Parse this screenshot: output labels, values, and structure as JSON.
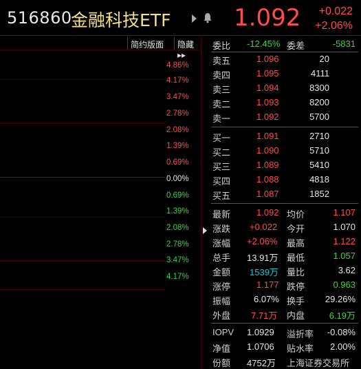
{
  "header": {
    "code": "516860",
    "name": "金融科技ETF",
    "price": "1.092",
    "change_abs": "+0.022",
    "change_pct": "+2.06%"
  },
  "chart": {
    "toolbar": {
      "simple_layout": "简约版面",
      "hide": "隐藏 ▸▸"
    },
    "pct_labels": [
      "4.86%",
      "4.17%",
      "3.47%",
      "2.78%",
      "2.08%",
      "1.39%",
      "0.69%",
      "0.00%",
      "0.69%",
      "1.39%",
      "2.08%",
      "2.78%",
      "3.47%",
      "4.17%"
    ]
  },
  "commission": {
    "ratio_label": "委比",
    "ratio": "-12.45%",
    "diff_label": "委差",
    "diff": "-5831"
  },
  "asks": [
    {
      "label": "卖五",
      "price": "1.096",
      "vol": "20"
    },
    {
      "label": "卖四",
      "price": "1.095",
      "vol": "4111"
    },
    {
      "label": "卖三",
      "price": "1.094",
      "vol": "8300"
    },
    {
      "label": "卖二",
      "price": "1.093",
      "vol": "8200"
    },
    {
      "label": "卖一",
      "price": "1.092",
      "vol": "5700"
    }
  ],
  "bids": [
    {
      "label": "买一",
      "price": "1.091",
      "vol": "2710"
    },
    {
      "label": "买二",
      "price": "1.090",
      "vol": "5710"
    },
    {
      "label": "买三",
      "price": "1.089",
      "vol": "5410"
    },
    {
      "label": "买四",
      "price": "1.088",
      "vol": "4818"
    },
    {
      "label": "买五",
      "price": "1.087",
      "vol": "1852"
    }
  ],
  "stats": {
    "latest_label": "最新",
    "latest": "1.092",
    "avg_label": "均价",
    "avg": "1.107",
    "chg_label": "涨跌",
    "chg": "+0.022",
    "open_label": "今开",
    "open": "1.070",
    "chgpct_label": "涨幅",
    "chgpct": "+2.06%",
    "high_label": "最高",
    "high": "1.122",
    "hand_label": "总手",
    "hand": "13.91万",
    "low_label": "最低",
    "low": "1.057",
    "amount_label": "金额",
    "amount": "1539万",
    "volratio_label": "量比",
    "volratio": "3.62",
    "limitup_label": "涨停",
    "limitup": "1.177",
    "limitdown_label": "跌停",
    "limitdown": "0.963",
    "amp_label": "振幅",
    "amp": "6.07%",
    "turnover_label": "换手",
    "turnover": "29.26%",
    "outer_label": "外盘",
    "outer": "7.71万",
    "inner_label": "内盘",
    "inner": "6.19万"
  },
  "fund": {
    "iopv_label": "IOPV",
    "iopv": "1.0929",
    "premium_label": "溢折率",
    "premium": "-0.08%",
    "nav_label": "净值",
    "nav": "1.0706",
    "discount_label": "贴水率",
    "discount": "2.00%",
    "shares_label": "份额",
    "shares": "4752万",
    "exchange": "上海证券交易所"
  },
  "colors": {
    "up": "#ff4b4b",
    "down": "#3cd63c",
    "name": "#f0e08a",
    "amount": "#19c9d8"
  }
}
